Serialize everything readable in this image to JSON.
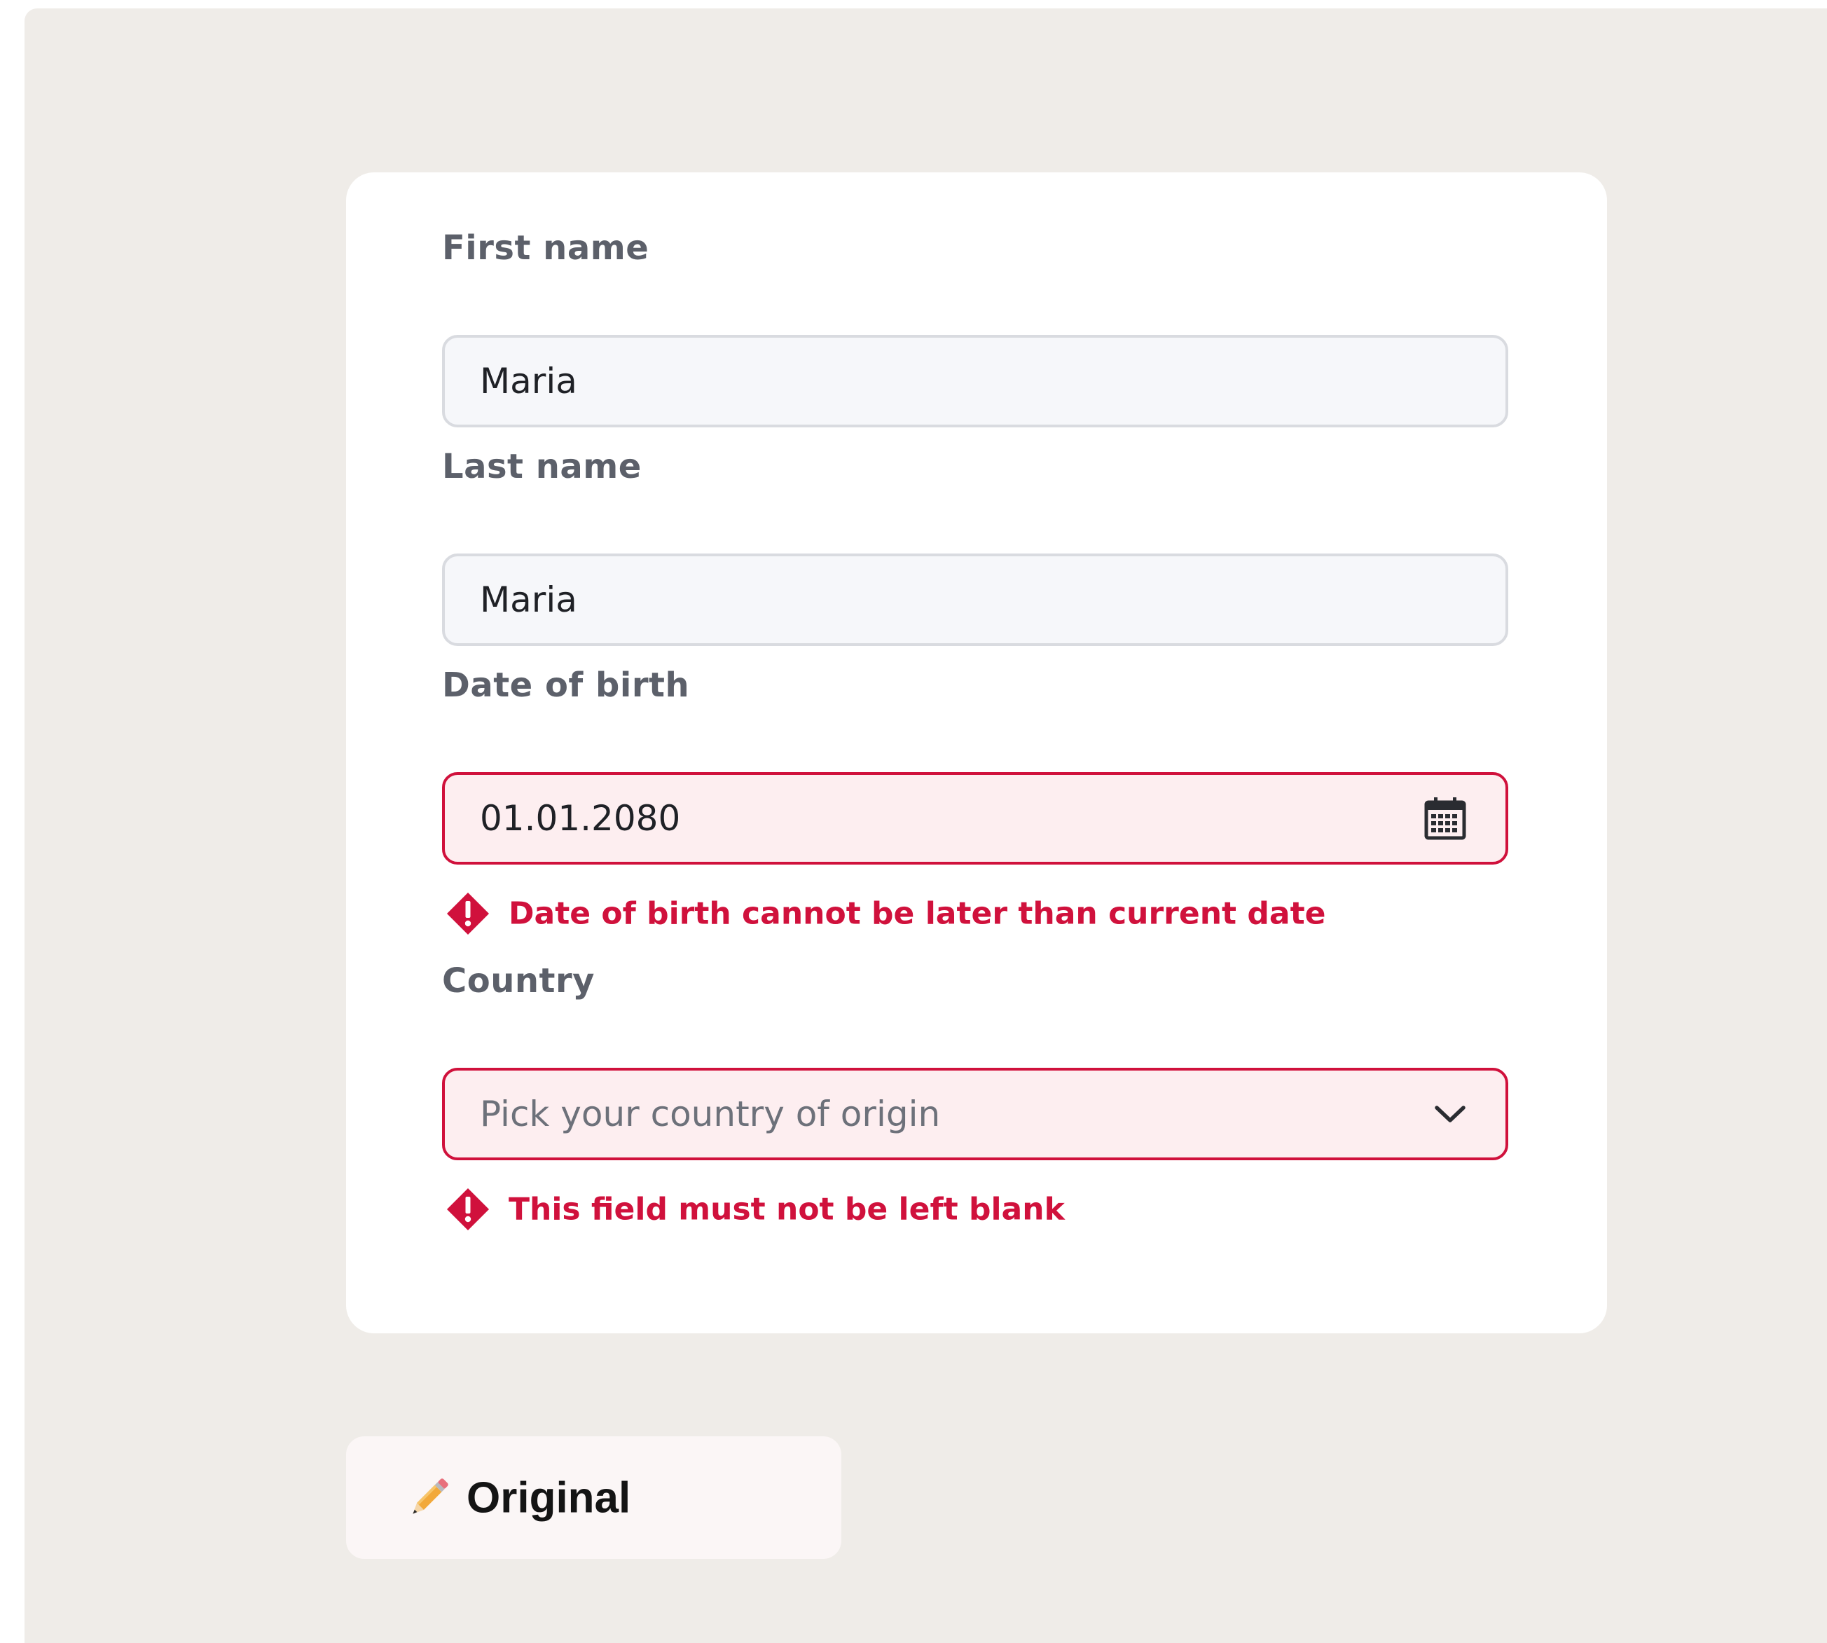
{
  "form": {
    "first_name": {
      "label": "First name",
      "value": "Maria"
    },
    "last_name": {
      "label": "Last name",
      "value": "Maria"
    },
    "date_of_birth": {
      "label": "Date of birth",
      "value": "01.01.2080",
      "icon": "calendar-icon",
      "error": "Date of birth cannot be later than current date"
    },
    "country": {
      "label": "Country",
      "placeholder": "Pick your country of origin",
      "icon": "chevron-down-icon",
      "error": "This field must not be left blank"
    }
  },
  "toggle": {
    "icon": "pencil-icon",
    "label": "Original"
  },
  "colors": {
    "background": "#efece8",
    "card": "#ffffff",
    "error": "#d0113c",
    "error_field_fill": "#fdeef0",
    "field_fill": "#f6f7fa",
    "label": "#5c606a"
  }
}
